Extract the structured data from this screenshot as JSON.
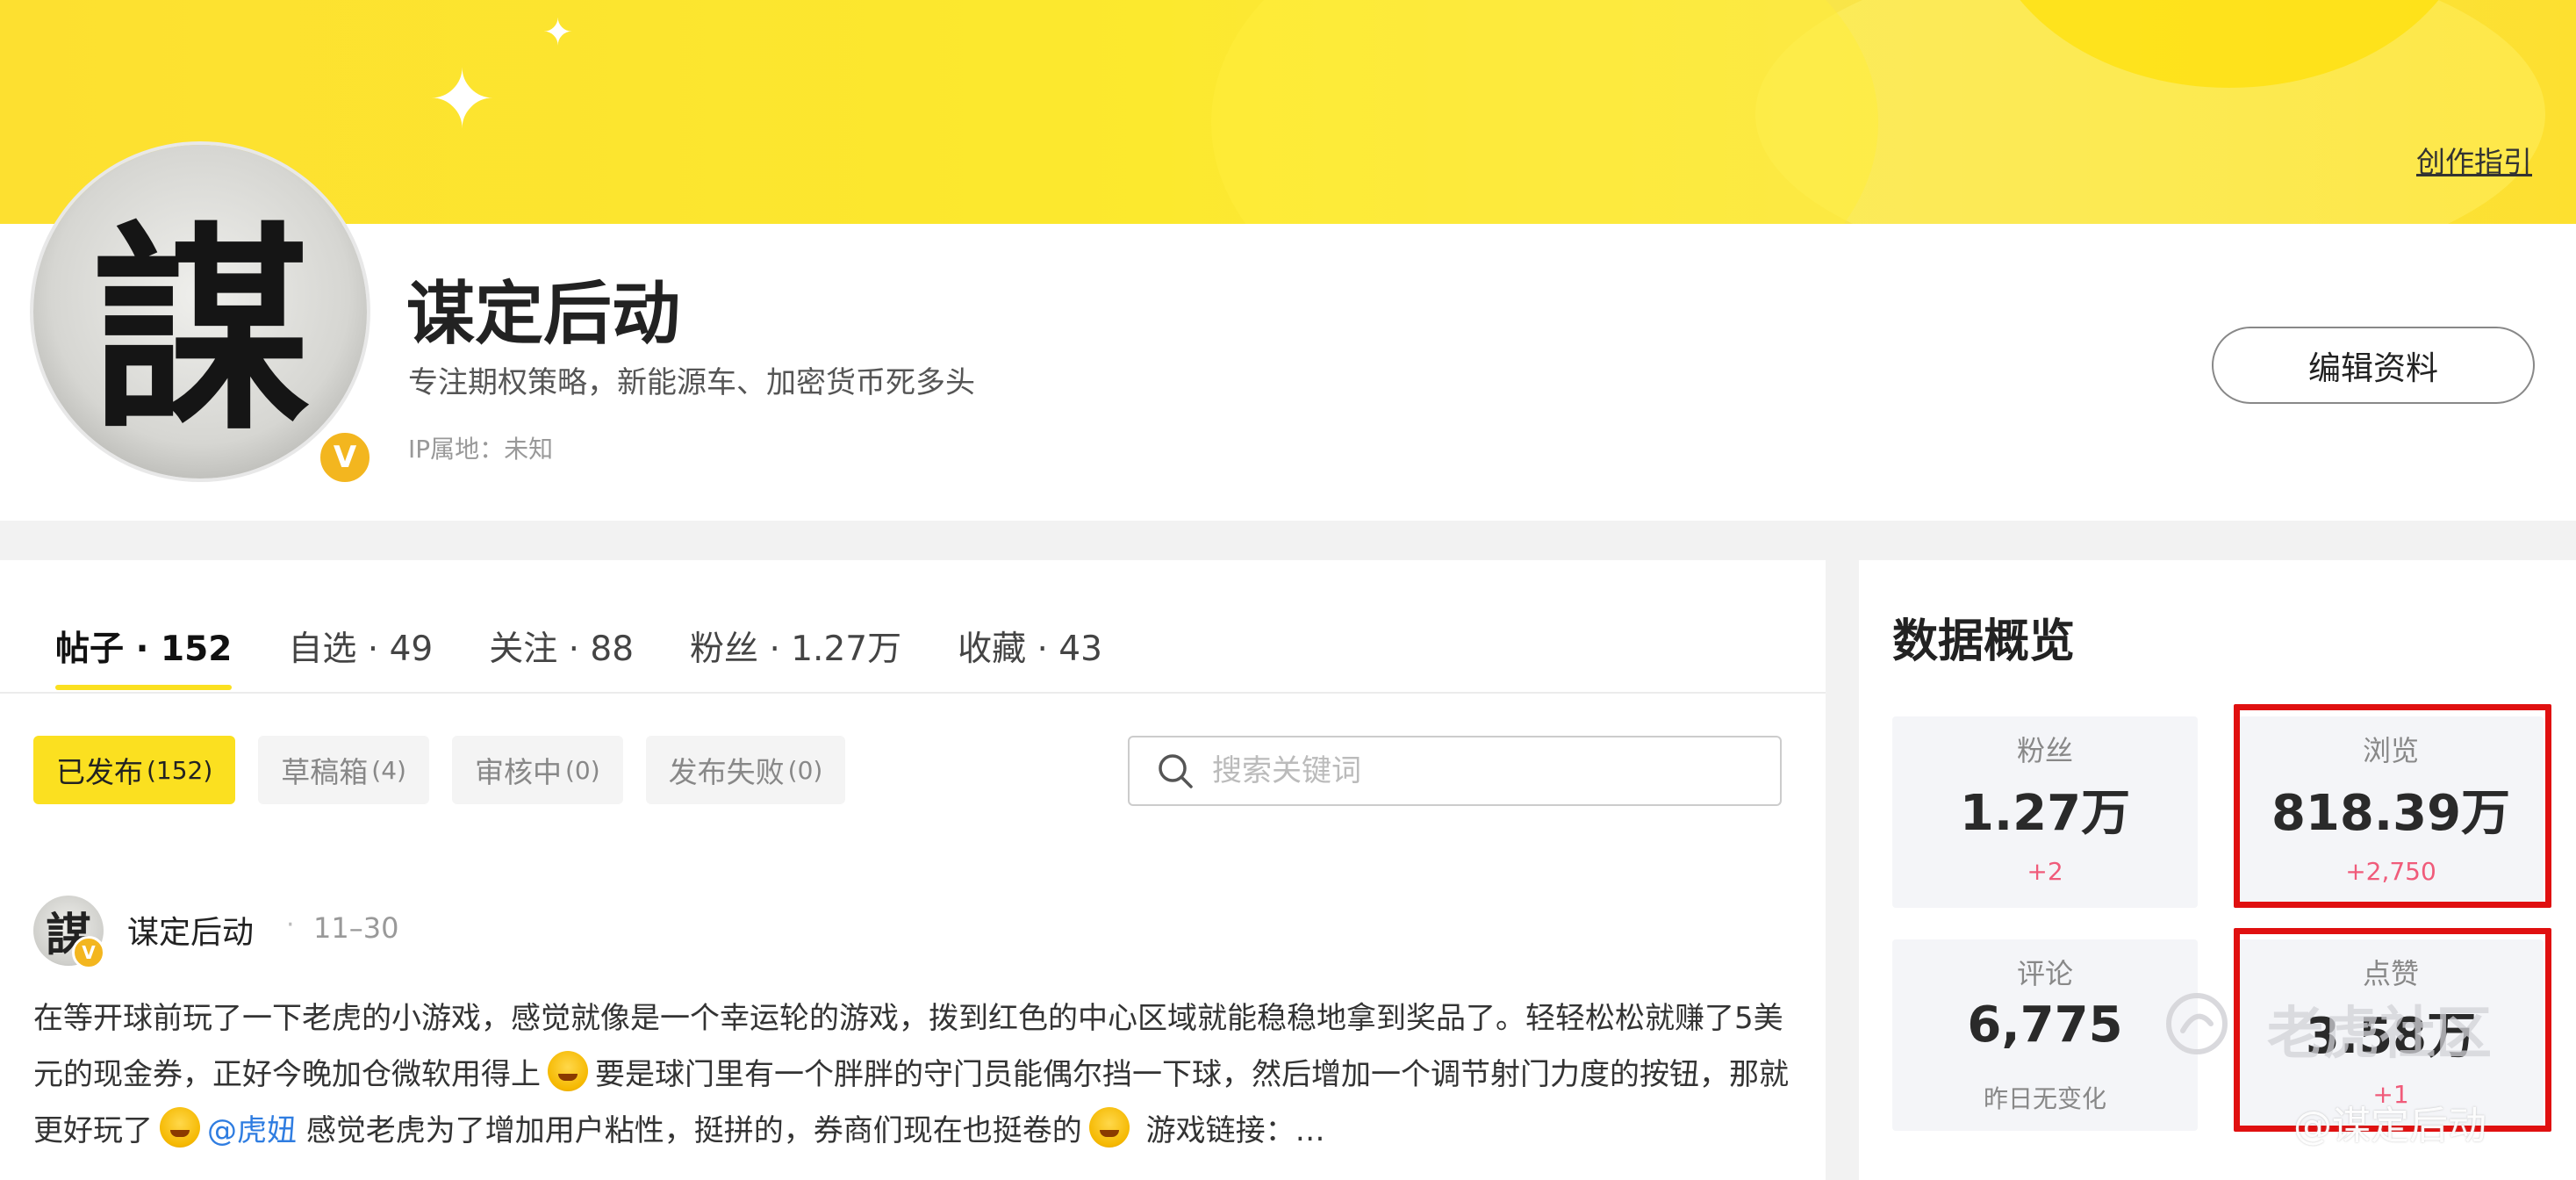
{
  "banner": {
    "guide_link": "创作指引"
  },
  "profile": {
    "avatar_char": "謀",
    "badge": "V",
    "username": "谋定后动",
    "bio": "专注期权策略，新能源车、加密货币死多头",
    "ip_location": "IP属地：未知",
    "edit_button": "编辑资料"
  },
  "tabs": [
    {
      "label": "帖子 · 152",
      "active": true
    },
    {
      "label": "自选 · 49",
      "active": false
    },
    {
      "label": "关注 · 88",
      "active": false
    },
    {
      "label": "粉丝 · 1.27万",
      "active": false
    },
    {
      "label": "收藏 · 43",
      "active": false
    }
  ],
  "filters": [
    {
      "label": "已发布",
      "count": "(152)",
      "active": true
    },
    {
      "label": "草稿箱",
      "count": "(4)",
      "active": false
    },
    {
      "label": "审核中",
      "count": "(0)",
      "active": false
    },
    {
      "label": "发布失败",
      "count": "(0)",
      "active": false
    }
  ],
  "search": {
    "placeholder": "搜索关键词"
  },
  "post": {
    "avatar_char": "謀",
    "badge": "V",
    "author": "谋定后动",
    "separator": "·",
    "date": "11–30",
    "text_1": "在等开球前玩了一下老虎的小游戏，感觉就像是一个幸运轮的游戏，拨到红色的中心区域就能稳稳地拿到奖品了。轻轻松松就赚了5美元的现金券，正好今晚加仓微软用得上",
    "text_2": "要是球门里有一个胖胖的守门员能偶尔挡一下球，然后增加一个调节射门力度的按钮，那就更好玩了",
    "mention": "@虎妞",
    "text_3": "感觉老虎为了增加用户粘性，挺拼的，券商们现在也挺卷的",
    "text_4": "游戏链接：…"
  },
  "overview": {
    "title": "数据概览",
    "stats": [
      {
        "label": "粉丝",
        "value": "1.27万",
        "delta": "+2",
        "highlighted": false
      },
      {
        "label": "浏览",
        "value": "818.39万",
        "delta": "+2,750",
        "highlighted": true
      },
      {
        "label": "评论",
        "value": "6,775",
        "delta": "昨日无变化",
        "highlighted": false
      },
      {
        "label": "点赞",
        "value": "3.58万",
        "delta": "+1",
        "highlighted": true
      }
    ]
  },
  "watermark": {
    "main": "老虎社区",
    "sub": "@谋定后动"
  },
  "colors": {
    "accent": "#fbe020",
    "highlight": "#e01010",
    "delta_positive": "#f05b7a",
    "mention": "#2f7de1"
  }
}
